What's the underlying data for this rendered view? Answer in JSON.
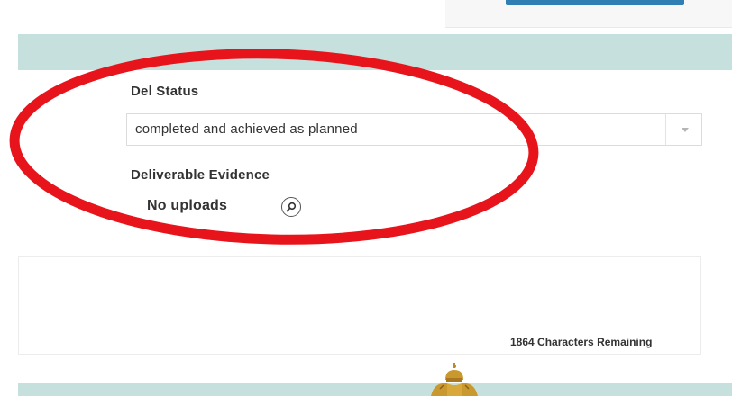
{
  "form": {
    "del_status": {
      "label": "Del Status",
      "selected_value": "completed and achieved as planned"
    },
    "deliverable_evidence": {
      "label": "Deliverable Evidence",
      "uploads_text": "No uploads"
    },
    "comment": {
      "remaining_text": "1864 Characters Remaining"
    }
  },
  "colors": {
    "header_band": "#c6e1dd",
    "highlight": "#e8141c",
    "primary_button": "#2f7fb3"
  },
  "icons": {
    "search": "magnifier-icon",
    "select_caret": "chevron-down-icon",
    "emblem": "coat-of-arms-emblem"
  }
}
